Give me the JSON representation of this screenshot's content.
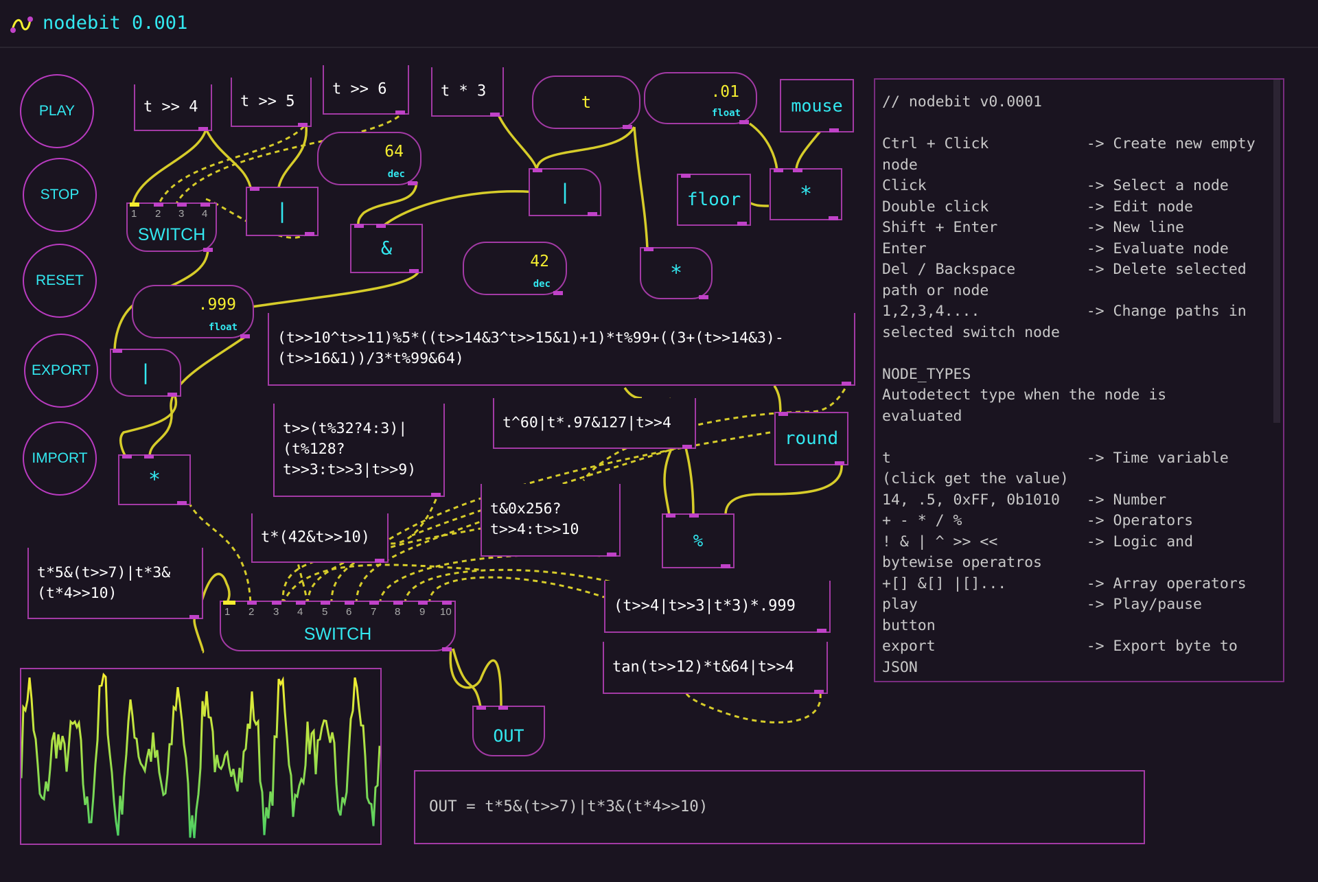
{
  "app": {
    "title": "nodebit 0.001"
  },
  "sidebar": {
    "buttons": [
      "PLAY",
      "STOP",
      "RESET",
      "EXPORT",
      "IMPORT"
    ]
  },
  "nodes": {
    "t_shr_4": "t >> 4",
    "t_shr_5": "t >> 5",
    "t_shr_6": "t >> 6",
    "t_mul_3": "t * 3",
    "t_var": "t",
    "float_01": {
      "value": ".01",
      "unit": "float"
    },
    "mouse": "mouse",
    "dec_64": {
      "value": "64",
      "unit": "dec"
    },
    "dec_42": {
      "value": "42",
      "unit": "dec"
    },
    "float_999": {
      "value": ".999",
      "unit": "float"
    },
    "or_1": "|",
    "or_2": "|",
    "or_3": "|",
    "and_1": "&",
    "floor": "floor",
    "mul_1": "*",
    "mul_2": "*",
    "mul_3": "*",
    "mod_1": "%",
    "round": "round",
    "long_expr": "(t>>10^t>>11)%5*((t>>14&3^t>>15&1)+1)*t%99+((3+(t>>14&3)-\n(t>>16&1))/3*t%99&64)",
    "expr_ternary": "t>>(t%32?4:3)|\n(t%128?\nt>>3:t>>3|t>>9)",
    "expr_xor": "t^60|t*.97&127|t>>4",
    "expr_hex": "t&0x256?\nt>>4:t>>10",
    "expr_mul42": "t*(42&t>>10)",
    "expr_t5": "t*5&(t>>7)|t*3&\n(t*4>>10)",
    "expr_or999": "(t>>4|t>>3|t*3)*.999",
    "expr_tan": "tan(t>>12)*t&64|t>>4",
    "switch_small": {
      "label": "SWITCH",
      "inputs": [
        "1",
        "2",
        "3",
        "4"
      ],
      "selected": "1"
    },
    "switch_big": {
      "label": "SWITCH",
      "inputs": [
        "1",
        "2",
        "3",
        "4",
        "5",
        "6",
        "7",
        "8",
        "9",
        "10"
      ],
      "selected": "1"
    },
    "out": "OUT"
  },
  "help": {
    "text": "// nodebit v0.0001\n\nCtrl + Click           -> Create new empty\nnode\nClick                  -> Select a node\nDouble click           -> Edit node\nShift + Enter          -> New line\nEnter                  -> Evaluate node\nDel / Backspace        -> Delete selected\npath or node\n1,2,3,4....            -> Change paths in\nselected switch node\n\nNODE_TYPES\nAutodetect type when the node is\nevaluated\n\nt                      -> Time variable\n(click get the value)\n14, .5, 0xFF, 0b1010   -> Number\n+ - * / %              -> Operators\n! & | ^ >> <<          -> Logic and\nbytewise operatros\n+[] &[] |[]...         -> Array operators\nplay                   -> Play/pause\nbutton\nexport                 -> Export byte to\nJSON"
  },
  "output": {
    "expression": "OUT = t*5&(t>>7)|t*3&(t*4>>10)"
  },
  "colors": {
    "background": "#1a1420",
    "node_border": "#a33aa5",
    "accent_cyan": "#33e8f0",
    "accent_yellow": "#f5ee30",
    "wire": "#d6cc2a"
  }
}
